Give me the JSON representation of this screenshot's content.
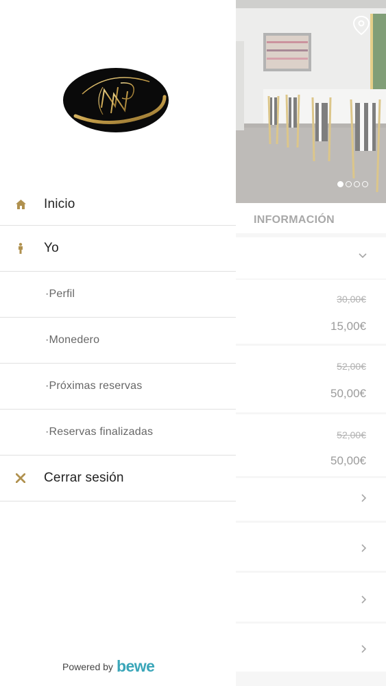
{
  "drawer": {
    "items": [
      {
        "label": "Inicio",
        "icon": "home-icon"
      },
      {
        "label": "Yo",
        "icon": "person-icon"
      },
      {
        "label": "·Perfil"
      },
      {
        "label": "·Monedero"
      },
      {
        "label": "·Próximas reservas"
      },
      {
        "label": "·Reservas finalizadas"
      },
      {
        "label": "Cerrar sesión",
        "icon": "close-icon"
      }
    ],
    "powered_by": "Powered by",
    "brand": "bewe"
  },
  "background": {
    "section_title": "INFORMACIÓN",
    "prices": [
      {
        "old": "30,00€",
        "new": "15,00€"
      },
      {
        "old": "52,00€",
        "new": "50,00€"
      },
      {
        "old": "52,00€",
        "new": "50,00€"
      }
    ],
    "carousel_dots": 4,
    "active_dot": 0
  },
  "colors": {
    "accent_gold": "#b0914f",
    "brand_teal": "#3aa6b9"
  }
}
